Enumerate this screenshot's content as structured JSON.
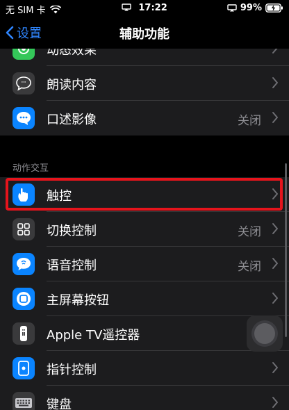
{
  "status_bar": {
    "carrier": "无 SIM 卡",
    "time": "17:22",
    "battery": "99%"
  },
  "nav": {
    "back_label": "设置",
    "title": "辅助功能"
  },
  "section_top": {
    "items": [
      {
        "label": "动态效果",
        "value": "",
        "icon": "motion-icon",
        "color": "#34c759"
      },
      {
        "label": "朗读内容",
        "value": "",
        "icon": "speech-bubble-icon",
        "color": "#3a3a3c"
      },
      {
        "label": "口述影像",
        "value": "关闭",
        "icon": "audio-description-icon",
        "color": "#0a84ff"
      }
    ]
  },
  "section_interaction": {
    "header": "动作交互",
    "items": [
      {
        "label": "触控",
        "value": "",
        "icon": "hand-touch-icon",
        "color": "#0a84ff"
      },
      {
        "label": "切换控制",
        "value": "关闭",
        "icon": "grid-icon",
        "color": "#3a3a3c"
      },
      {
        "label": "语音控制",
        "value": "关闭",
        "icon": "voice-control-icon",
        "color": "#0a84ff"
      },
      {
        "label": "主屏幕按钮",
        "value": "",
        "icon": "home-button-icon",
        "color": "#0a84ff"
      },
      {
        "label": "Apple TV遥控器",
        "value": "",
        "icon": "remote-icon",
        "color": "#3a3a3c"
      },
      {
        "label": "指针控制",
        "value": "",
        "icon": "pointer-icon",
        "color": "#0a84ff"
      },
      {
        "label": "键盘",
        "value": "",
        "icon": "keyboard-icon",
        "color": "#3a3a3c"
      }
    ]
  },
  "colors": {
    "accent": "#2f86ff",
    "highlight": "#e5141c"
  }
}
